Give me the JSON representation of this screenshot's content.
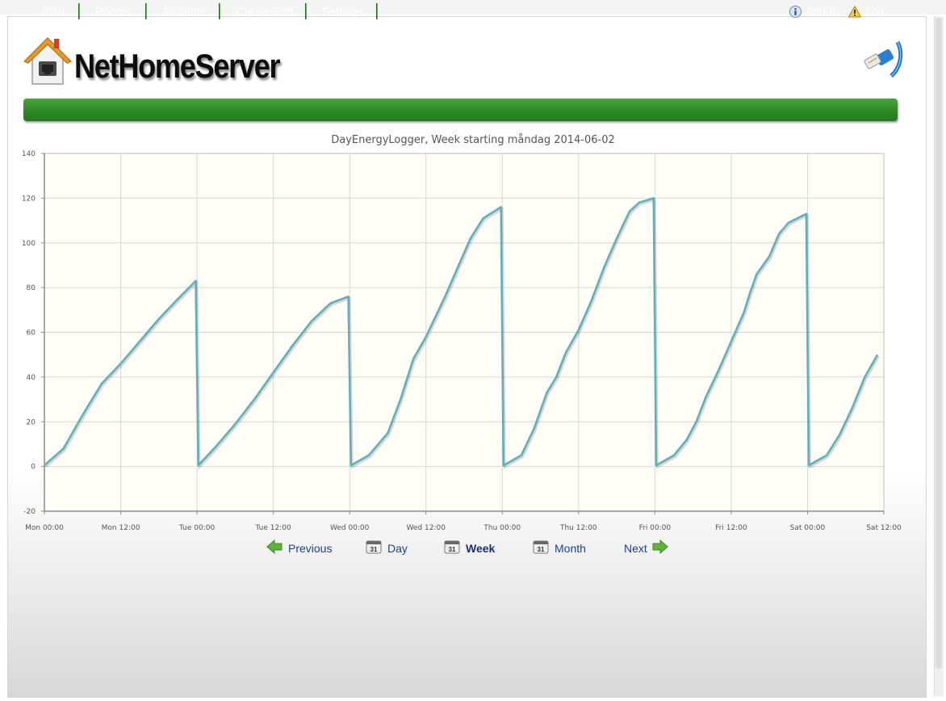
{
  "app": {
    "logo_text": "NetHomeServer"
  },
  "nav": {
    "items": [
      {
        "label": "Plan"
      },
      {
        "label": "Rooms"
      },
      {
        "label": "All Items"
      },
      {
        "label": "Create/Edit"
      },
      {
        "label": "Settings"
      }
    ],
    "about_label": "About",
    "log_label": "Log"
  },
  "icons": {
    "logo": "house-icon",
    "network": "network-cable-icon",
    "about": "info-icon",
    "log": "warning-icon",
    "previous": "arrow-left-icon",
    "next": "arrow-right-icon",
    "calendar": "calendar-icon"
  },
  "colors": {
    "nav_green": "#2f8a26",
    "series_line": "#5fafbf",
    "plot_background": "#fefdf6",
    "link_blue": "#1a3f99"
  },
  "chart_data": {
    "type": "line",
    "title": "DayEnergyLogger, Week starting måndag 2014-06-02",
    "xlabel": "",
    "ylabel": "",
    "x_unit": "hours since Mon 00:00",
    "xlim": [
      0,
      132
    ],
    "ylim": [
      -20,
      140
    ],
    "grid": true,
    "legend": "none",
    "x_ticks": [
      {
        "value": 0,
        "label": "Mon 00:00"
      },
      {
        "value": 12,
        "label": "Mon 12:00"
      },
      {
        "value": 24,
        "label": "Tue 00:00"
      },
      {
        "value": 36,
        "label": "Tue 12:00"
      },
      {
        "value": 48,
        "label": "Wed 00:00"
      },
      {
        "value": 60,
        "label": "Wed 12:00"
      },
      {
        "value": 72,
        "label": "Thu 00:00"
      },
      {
        "value": 84,
        "label": "Thu 12:00"
      },
      {
        "value": 96,
        "label": "Fri 00:00"
      },
      {
        "value": 108,
        "label": "Fri 12:00"
      },
      {
        "value": 120,
        "label": "Sat 00:00"
      },
      {
        "value": 132,
        "label": "Sat 12:00"
      }
    ],
    "y_ticks": [
      -20,
      0,
      20,
      40,
      60,
      80,
      100,
      120,
      140
    ],
    "series": [
      {
        "name": "",
        "x": [
          0,
          3,
          6,
          9,
          12,
          15,
          18,
          21,
          23.8,
          24.2,
          27,
          30,
          33,
          36,
          39,
          42,
          45,
          47.8,
          48.2,
          51,
          54,
          56,
          58,
          60,
          63,
          65,
          67,
          69,
          71.8,
          72.2,
          75,
          77,
          79,
          80.5,
          82,
          84,
          86,
          88,
          90,
          92,
          93.5,
          95.8,
          96.2,
          99,
          101,
          102.5,
          104,
          106,
          108,
          110,
          111,
          112,
          114,
          115.5,
          117,
          119.8,
          120.2,
          123,
          125,
          127,
          129,
          131
        ],
        "values": [
          0.5,
          8,
          23,
          37,
          46,
          56,
          66,
          75,
          83,
          0.5,
          9,
          19,
          30,
          42,
          54,
          65,
          73,
          76,
          0.5,
          5,
          15,
          30,
          48,
          58,
          76,
          89,
          102,
          111,
          116,
          0.5,
          5,
          17,
          33,
          40,
          51,
          61,
          74,
          89,
          102,
          114,
          118,
          120,
          0.5,
          5,
          12,
          20,
          31,
          43,
          56,
          69,
          78,
          86,
          94,
          104,
          109,
          113,
          0.5,
          5,
          14,
          26,
          40,
          50
        ]
      }
    ]
  },
  "pager": {
    "previous_label": "Previous",
    "day_label": "Day",
    "week_label": "Week",
    "month_label": "Month",
    "next_label": "Next",
    "calendar_number": "31",
    "active": "Week"
  }
}
